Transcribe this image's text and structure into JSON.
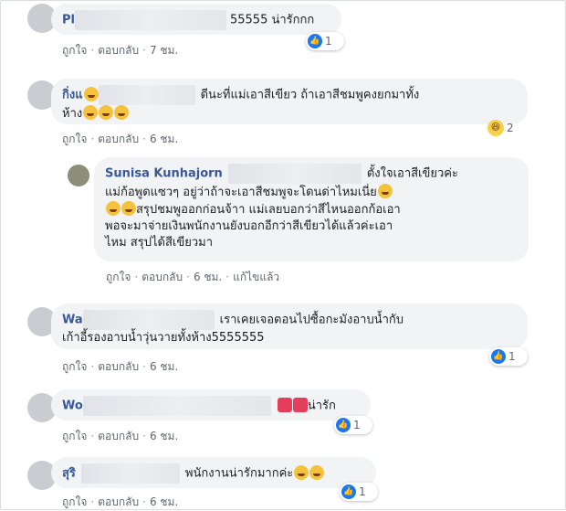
{
  "comments": [
    {
      "name_visible": "Pl",
      "text": "55555 น่ารักกก",
      "actions": [
        "ถูกใจ",
        "ตอบกลับ",
        "7 ชม."
      ],
      "reaction_count": "1"
    },
    {
      "name_visible": "กิ่งแ",
      "text_line1": "ดีนะที่แม่เอาสีเขียว ถ้าเอาสีชมพูคงยกมาทั้ง",
      "text_line2": "ห้าง",
      "actions": [
        "ถูกใจ",
        "ตอบกลับ",
        "6 ชม."
      ],
      "reaction_count": "2"
    },
    {
      "name_visible": "Wa",
      "text_line1": "เราเคยเจอตอนไปซื้อกะมังอาบน้ำกับ",
      "text_line2": "เก้าอี้รองอาบน้ำวุ่นวายทั้งห้าง5555555",
      "actions": [
        "ถูกใจ",
        "ตอบกลับ",
        "6 ชม."
      ],
      "reaction_count": "1"
    },
    {
      "name_visible": "Wo",
      "text": "น่ารัก",
      "actions": [
        "ถูกใจ",
        "ตอบกลับ",
        "6 ชม."
      ],
      "reaction_count": "1"
    },
    {
      "name_visible": "สุริ",
      "text": "พนักงานน่ารักมากค่ะ",
      "actions": [
        "ถูกใจ",
        "ตอบกลับ",
        "6 ชม."
      ],
      "reaction_count": "1"
    }
  ],
  "reply": {
    "name": "Sunisa Kunhajorn",
    "line1": "ตั้งใจเอาสีเขียวค่ะ",
    "line2": "แม่ก้อพูดแซวๆ อยู่ว่าถ้าจะเอาสีชมพูจะโดนด่าไหมเนี่ย",
    "line3": "สรุปชมพูออกก่อนจ้าา แม่เลยบอกว่าสีไหนออกก้อเอา",
    "line4": "พอจะมาจ่ายเงินพนักงานยังบอกอีกว่าสีเขียวได้แล้วค่ะเอา",
    "line5": "ไหม สรุปได้สีเขียวมา",
    "actions": [
      "ถูกใจ",
      "ตอบกลับ",
      "6 ชม.",
      "แก้ไขแล้ว"
    ]
  },
  "icons": {
    "like": "like-reaction-icon",
    "haha": "haha-reaction-icon",
    "laugh_emoji": "rolling-laughing-emoji",
    "heart_emoji": "heart-emoji"
  }
}
